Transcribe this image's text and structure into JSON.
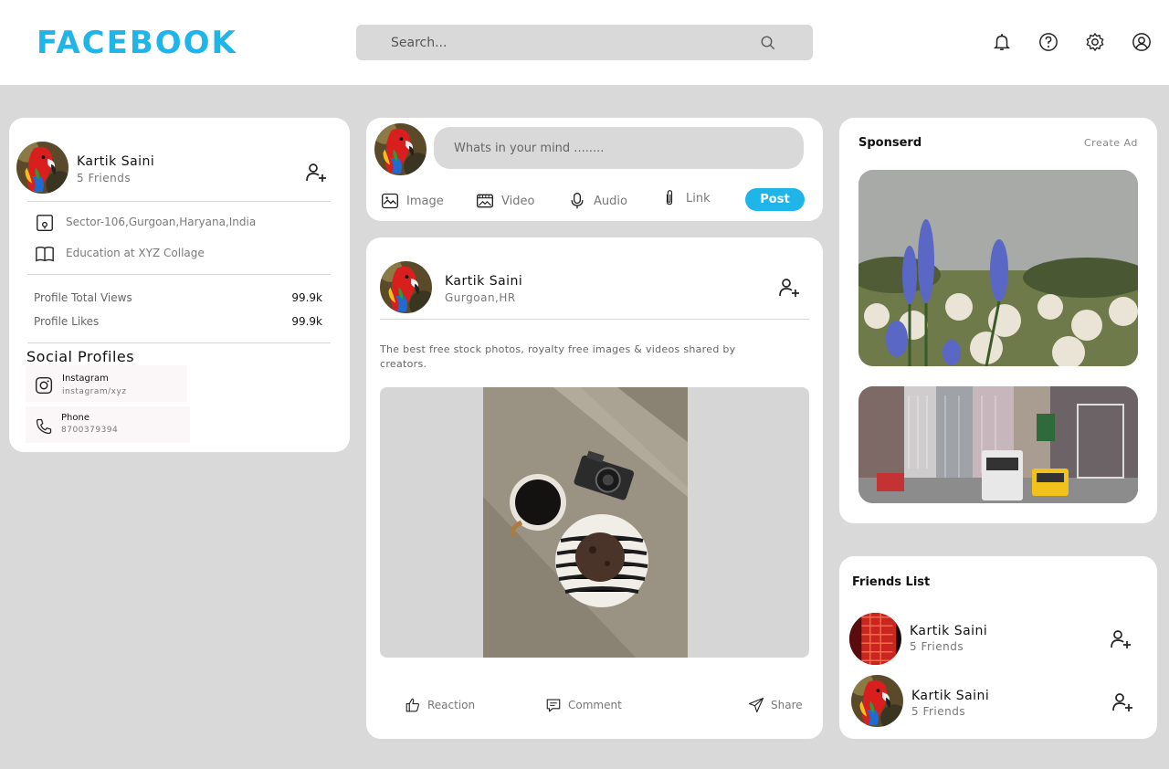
{
  "header": {
    "logo": "FACEBOOK",
    "search_placeholder": "Search...",
    "icons": [
      "bell-icon",
      "help-icon",
      "settings-icon",
      "account-icon"
    ]
  },
  "profile": {
    "name": "Kartik Saini",
    "friends": "5 Friends",
    "location": "Sector-106,Gurgoan,Haryana,India",
    "education": "Education at XYZ Collage",
    "stats": [
      {
        "label": "Profile Total Views",
        "value": "99.9k"
      },
      {
        "label": "Profile Likes",
        "value": "99.9k"
      }
    ],
    "social_title": "Social Profiles",
    "social": [
      {
        "label": "Instagram",
        "value": "instagram/xyz",
        "icon": "instagram-icon"
      },
      {
        "label": "Phone",
        "value": "8700379394",
        "icon": "phone-icon"
      }
    ]
  },
  "composer": {
    "placeholder": "Whats in your mind ........",
    "actions": [
      {
        "label": "Image",
        "icon": "image-icon"
      },
      {
        "label": "Video",
        "icon": "video-icon"
      },
      {
        "label": "Audio",
        "icon": "microphone-icon"
      },
      {
        "label": "Link",
        "icon": "paperclip-icon"
      }
    ],
    "post_label": "Post"
  },
  "post": {
    "author": "Kartik Saini",
    "location": "Gurgoan,HR",
    "text": "The best free stock photos, royalty free images & videos shared by creators.",
    "footer": [
      {
        "label": "Reaction",
        "icon": "thumbs-up-icon"
      },
      {
        "label": "Comment",
        "icon": "comment-icon"
      },
      {
        "label": "Share",
        "icon": "send-icon"
      }
    ]
  },
  "sponsored": {
    "title": "Sponserd",
    "create_ad": "Create Ad"
  },
  "friends": {
    "title": "Friends List",
    "items": [
      {
        "name": "Kartik Saini",
        "friends": "5 Friends"
      },
      {
        "name": "Kartik Saini",
        "friends": "5 Friends"
      }
    ]
  },
  "colors": {
    "accent": "#1fb5e8",
    "background": "#d9d9d9",
    "card": "#ffffff"
  }
}
